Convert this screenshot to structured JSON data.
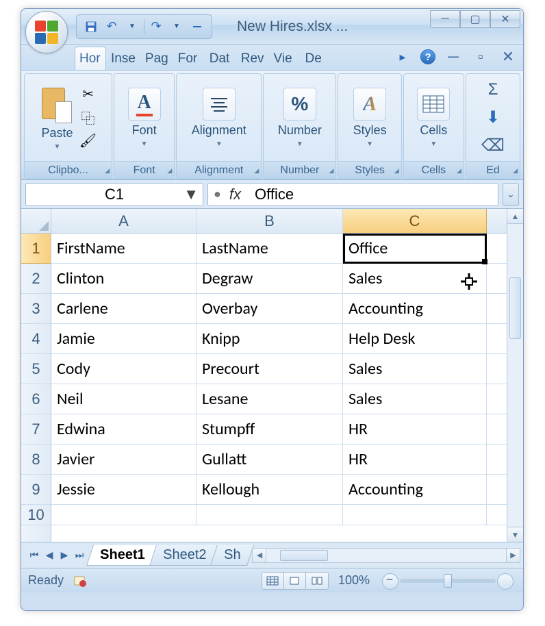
{
  "window": {
    "title": "New Hires.xlsx ..."
  },
  "ribbon": {
    "tabs": [
      "Hor",
      "Inse",
      "Pag",
      "For",
      "Dat",
      "Rev",
      "Vie",
      "De"
    ],
    "active_tab": 0,
    "groups": {
      "clipboard": {
        "label": "Clipbo...",
        "paste": "Paste"
      },
      "font": {
        "label": "Font"
      },
      "alignment": {
        "label": "Alignment"
      },
      "number": {
        "label": "Number"
      },
      "styles": {
        "label": "Styles"
      },
      "cells": {
        "label": "Cells"
      },
      "editing": {
        "label": "Ed"
      }
    }
  },
  "formula_bar": {
    "name_box": "C1",
    "fx": "fx",
    "value": "Office"
  },
  "grid": {
    "selected_cell": "C1",
    "columns": [
      "A",
      "B",
      "C"
    ],
    "column_widths": {
      "A": 212,
      "B": 214,
      "C": 210
    },
    "selected_column": "C",
    "selected_row": 1,
    "visible_rows": [
      1,
      2,
      3,
      4,
      5,
      6,
      7,
      8,
      9,
      10
    ],
    "headers": [
      "FirstName",
      "LastName",
      "Office"
    ],
    "data": [
      [
        "Clinton",
        "Degraw",
        "Sales"
      ],
      [
        "Carlene",
        "Overbay",
        "Accounting"
      ],
      [
        "Jamie",
        "Knipp",
        "Help Desk"
      ],
      [
        "Cody",
        "Precourt",
        "Sales"
      ],
      [
        "Neil",
        "Lesane",
        "Sales"
      ],
      [
        "Edwina",
        "Stumpff",
        "HR"
      ],
      [
        "Javier",
        "Gullatt",
        "HR"
      ],
      [
        "Jessie",
        "Kellough",
        "Accounting"
      ]
    ]
  },
  "sheets": {
    "tabs": [
      "Sheet1",
      "Sheet2",
      "Sh"
    ],
    "active": 0
  },
  "status": {
    "text": "Ready",
    "zoom": "100%"
  }
}
